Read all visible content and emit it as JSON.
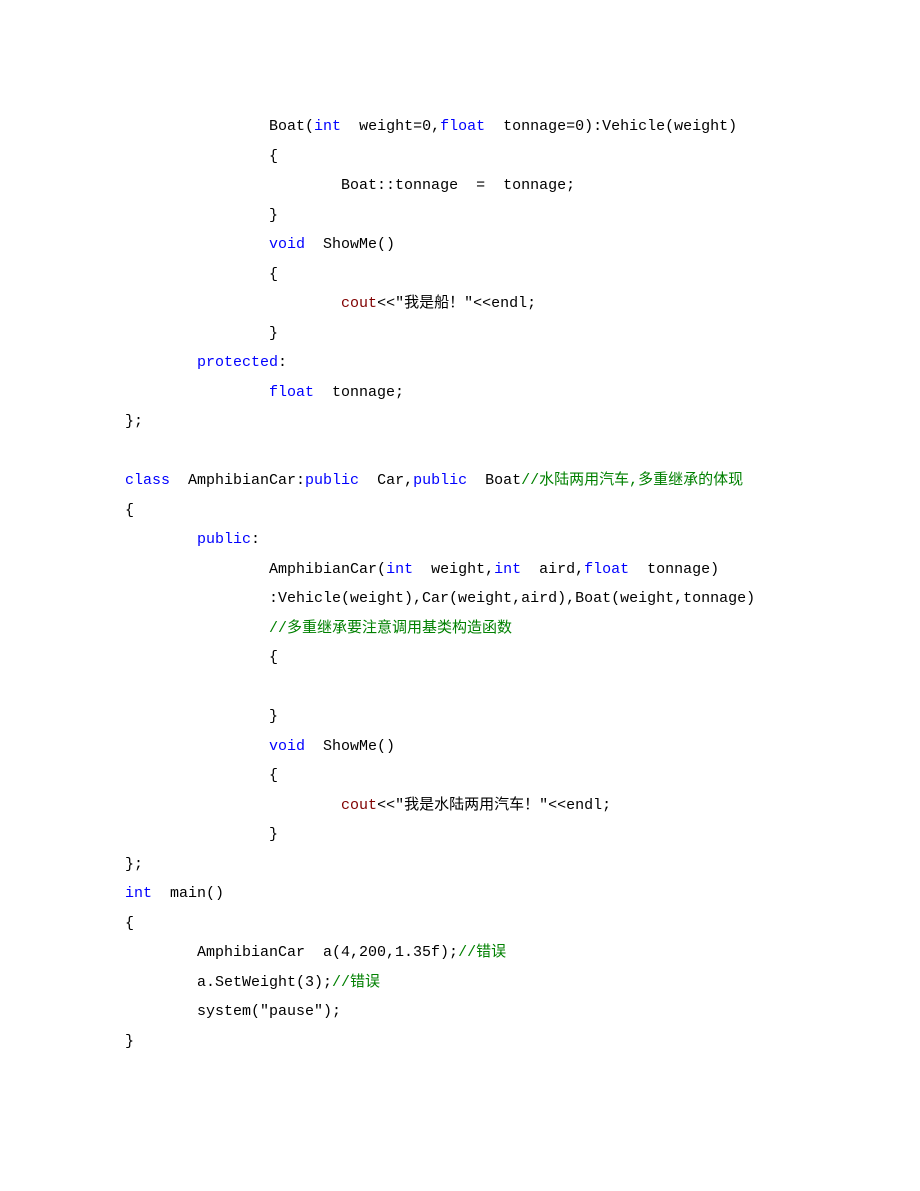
{
  "code": {
    "lines": [
      {
        "indent": 16,
        "tokens": [
          {
            "t": "Boat(",
            "c": "txt"
          },
          {
            "t": "int",
            "c": "ty"
          },
          {
            "t": "  weight=0,",
            "c": "txt"
          },
          {
            "t": "float",
            "c": "ty"
          },
          {
            "t": "  tonnage=0):Vehicle(weight)",
            "c": "txt"
          }
        ]
      },
      {
        "indent": 16,
        "tokens": [
          {
            "t": "{",
            "c": "txt"
          }
        ]
      },
      {
        "indent": 24,
        "tokens": [
          {
            "t": "Boat::tonnage  =  tonnage;",
            "c": "txt"
          }
        ]
      },
      {
        "indent": 16,
        "tokens": [
          {
            "t": "}",
            "c": "txt"
          }
        ]
      },
      {
        "indent": 16,
        "tokens": [
          {
            "t": "void",
            "c": "kw"
          },
          {
            "t": "  ShowMe()",
            "c": "txt"
          }
        ]
      },
      {
        "indent": 16,
        "tokens": [
          {
            "t": "{",
            "c": "txt"
          }
        ]
      },
      {
        "indent": 24,
        "tokens": [
          {
            "t": "cout",
            "c": "fn"
          },
          {
            "t": "<<\"我是船！\"<<endl;",
            "c": "txt"
          }
        ]
      },
      {
        "indent": 16,
        "tokens": [
          {
            "t": "}",
            "c": "txt"
          }
        ]
      },
      {
        "indent": 8,
        "tokens": [
          {
            "t": "protected",
            "c": "kw"
          },
          {
            "t": ":",
            "c": "txt"
          }
        ]
      },
      {
        "indent": 16,
        "tokens": [
          {
            "t": "float",
            "c": "ty"
          },
          {
            "t": "  tonnage;",
            "c": "txt"
          }
        ]
      },
      {
        "indent": 0,
        "tokens": [
          {
            "t": "};",
            "c": "txt"
          }
        ]
      },
      {
        "indent": 0,
        "tokens": [
          {
            "t": "",
            "c": "txt"
          }
        ]
      },
      {
        "indent": 0,
        "tokens": [
          {
            "t": "class",
            "c": "kw"
          },
          {
            "t": "  AmphibianCar:",
            "c": "txt"
          },
          {
            "t": "public",
            "c": "kw"
          },
          {
            "t": "  Car,",
            "c": "txt"
          },
          {
            "t": "public",
            "c": "kw"
          },
          {
            "t": "  Boat",
            "c": "txt"
          },
          {
            "t": "//水陆两用汽车,多重继承的体现",
            "c": "cm"
          }
        ]
      },
      {
        "indent": 0,
        "tokens": [
          {
            "t": "{",
            "c": "txt"
          }
        ]
      },
      {
        "indent": 8,
        "tokens": [
          {
            "t": "public",
            "c": "kw"
          },
          {
            "t": ":",
            "c": "txt"
          }
        ]
      },
      {
        "indent": 16,
        "tokens": [
          {
            "t": "AmphibianCar(",
            "c": "txt"
          },
          {
            "t": "int",
            "c": "ty"
          },
          {
            "t": "  weight,",
            "c": "txt"
          },
          {
            "t": "int",
            "c": "ty"
          },
          {
            "t": "  aird,",
            "c": "txt"
          },
          {
            "t": "float",
            "c": "ty"
          },
          {
            "t": "  tonnage)",
            "c": "txt"
          }
        ]
      },
      {
        "indent": 16,
        "tokens": [
          {
            "t": ":Vehicle(weight),Car(weight,aird),Boat(weight,tonnage)",
            "c": "txt"
          }
        ]
      },
      {
        "indent": 16,
        "tokens": [
          {
            "t": "//多重继承要注意调用基类构造函数",
            "c": "cm"
          }
        ]
      },
      {
        "indent": 16,
        "tokens": [
          {
            "t": "{",
            "c": "txt"
          }
        ]
      },
      {
        "indent": 16,
        "tokens": [
          {
            "t": "",
            "c": "txt"
          }
        ]
      },
      {
        "indent": 16,
        "tokens": [
          {
            "t": "}",
            "c": "txt"
          }
        ]
      },
      {
        "indent": 16,
        "tokens": [
          {
            "t": "void",
            "c": "kw"
          },
          {
            "t": "  ShowMe()",
            "c": "txt"
          }
        ]
      },
      {
        "indent": 16,
        "tokens": [
          {
            "t": "{",
            "c": "txt"
          }
        ]
      },
      {
        "indent": 24,
        "tokens": [
          {
            "t": "cout",
            "c": "fn"
          },
          {
            "t": "<<\"我是水陆两用汽车！\"<<endl;",
            "c": "txt"
          }
        ]
      },
      {
        "indent": 16,
        "tokens": [
          {
            "t": "}",
            "c": "txt"
          }
        ]
      },
      {
        "indent": 0,
        "tokens": [
          {
            "t": "};",
            "c": "txt"
          }
        ]
      },
      {
        "indent": 0,
        "tokens": [
          {
            "t": "int",
            "c": "ty"
          },
          {
            "t": "  main()",
            "c": "txt"
          }
        ]
      },
      {
        "indent": 0,
        "tokens": [
          {
            "t": "{",
            "c": "txt"
          }
        ]
      },
      {
        "indent": 8,
        "tokens": [
          {
            "t": "AmphibianCar  a(4,200,1.35f);",
            "c": "txt"
          },
          {
            "t": "//错误",
            "c": "cm"
          }
        ]
      },
      {
        "indent": 8,
        "tokens": [
          {
            "t": "a.SetWeight(3);",
            "c": "txt"
          },
          {
            "t": "//错误",
            "c": "cm"
          }
        ]
      },
      {
        "indent": 8,
        "tokens": [
          {
            "t": "system(\"pause\");",
            "c": "txt"
          }
        ]
      },
      {
        "indent": 0,
        "tokens": [
          {
            "t": "}",
            "c": "txt"
          }
        ]
      }
    ]
  }
}
